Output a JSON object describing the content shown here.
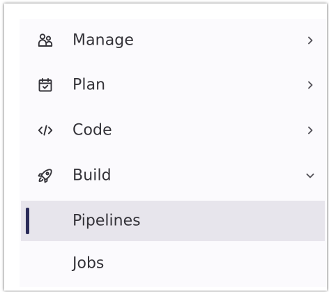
{
  "sidebar": {
    "items": [
      {
        "label": "Manage",
        "icon": "users-icon",
        "expanded": false
      },
      {
        "label": "Plan",
        "icon": "calendar-check-icon",
        "expanded": false
      },
      {
        "label": "Code",
        "icon": "code-icon",
        "expanded": false
      },
      {
        "label": "Build",
        "icon": "rocket-icon",
        "expanded": true
      }
    ],
    "build_subitems": [
      {
        "label": "Pipelines",
        "active": true
      },
      {
        "label": "Jobs",
        "active": false
      }
    ]
  },
  "colors": {
    "text": "#333238",
    "panel_background": "#fbfafd",
    "active_background": "#e7e5ec",
    "active_indicator": "#2a2b59"
  }
}
